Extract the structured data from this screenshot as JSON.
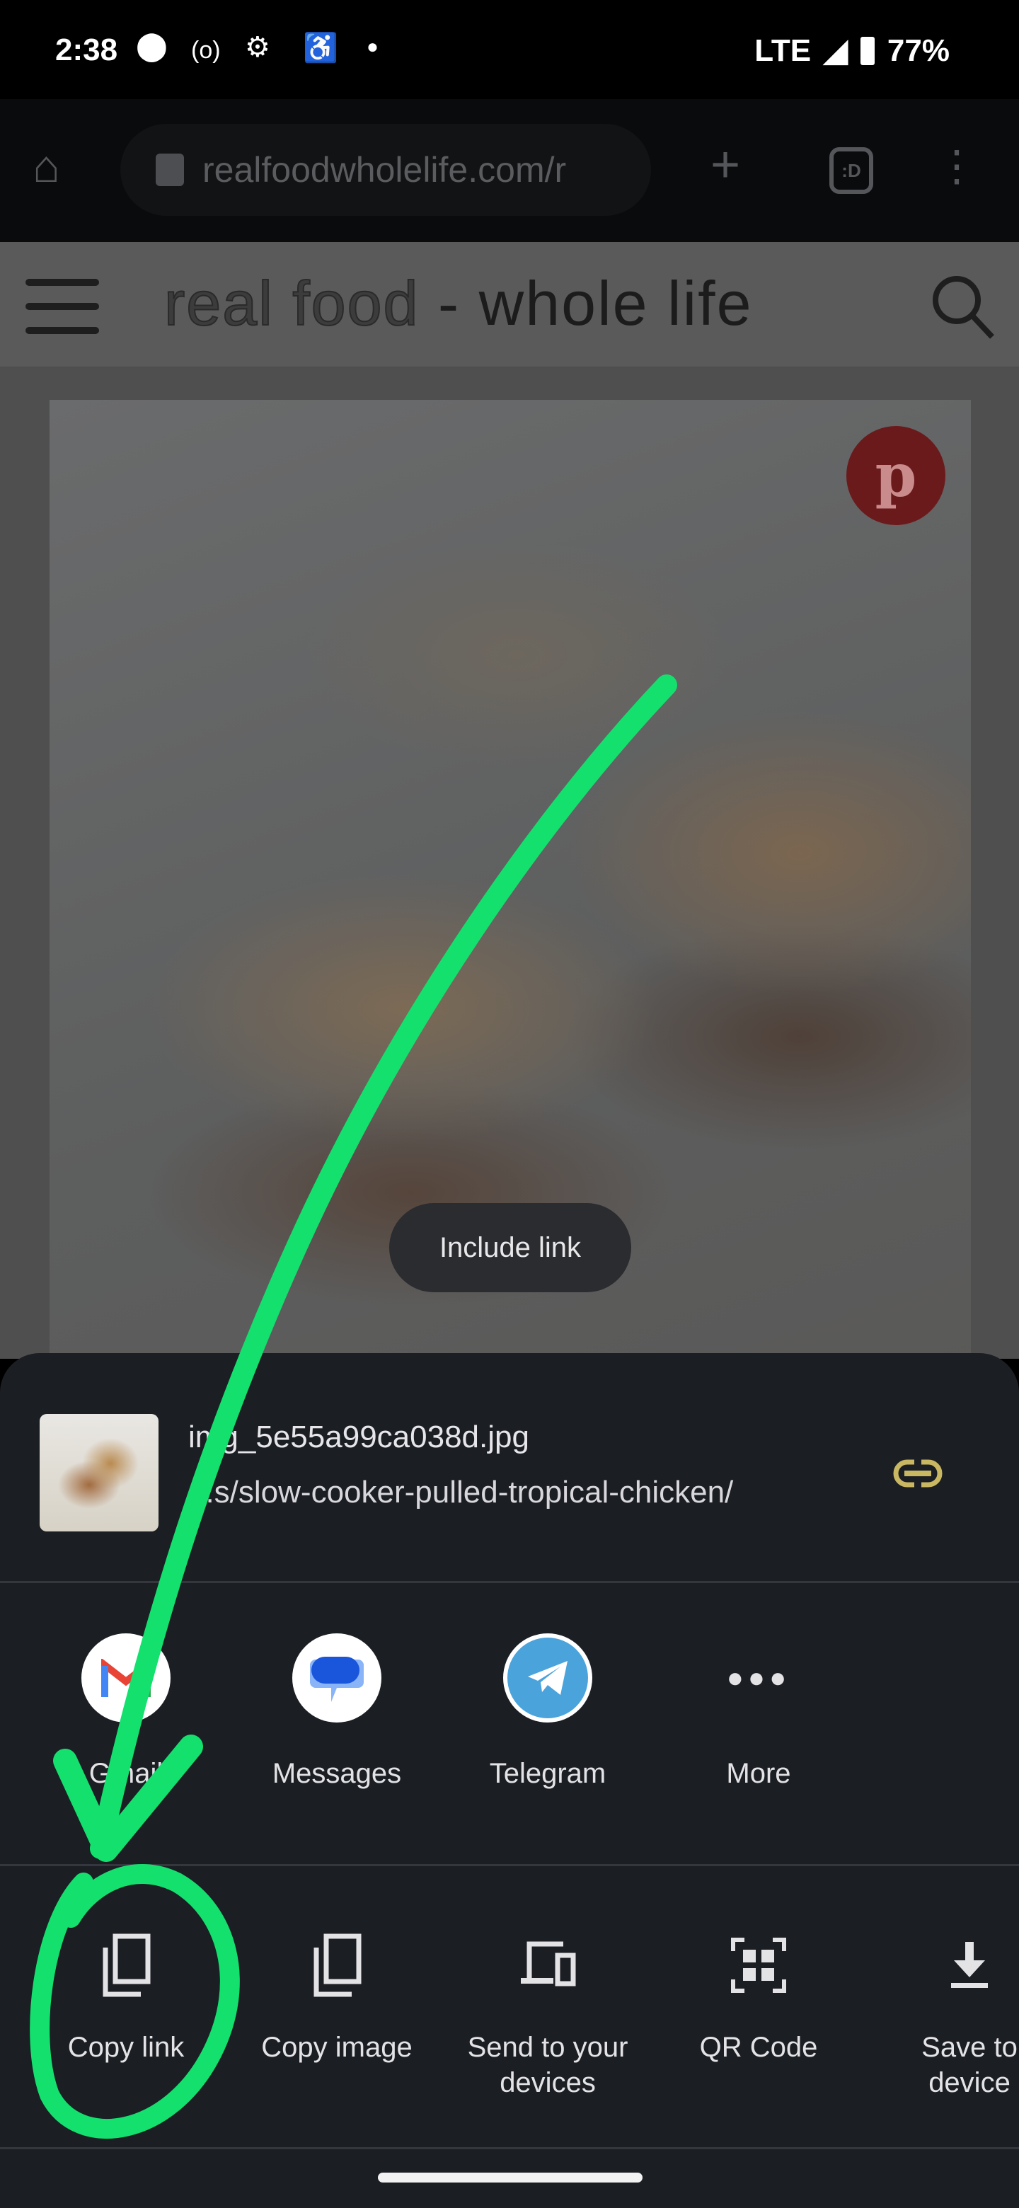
{
  "status_bar": {
    "time": "2:38",
    "network": "LTE",
    "battery": "77%",
    "icons": [
      "circle-notification-icon",
      "hotspot-icon",
      "android-debug-icon",
      "accessibility-icon",
      "dot-icon",
      "signal-icon",
      "battery-icon"
    ]
  },
  "browser": {
    "url": "realfoodwholelife.com/r",
    "tab_count": ":D",
    "icons": [
      "home-icon",
      "lock-icon",
      "new-tab-icon",
      "tab-switcher-icon",
      "menu-icon"
    ]
  },
  "site": {
    "logo_light": "real food",
    "logo_dark": "- whole life",
    "pinterest": "p"
  },
  "toast": {
    "label": "Include link"
  },
  "share_sheet": {
    "file_name": "img_5e55a99ca038d.jpg",
    "url": "...s/slow-cooker-pulled-tropical-chicken/",
    "link_icon_color": "#c9b861",
    "apps": [
      {
        "label": "Gmail"
      },
      {
        "label": "Messages"
      },
      {
        "label": "Telegram"
      },
      {
        "label": "More"
      }
    ],
    "actions": [
      {
        "label": "Copy link"
      },
      {
        "label": "Copy image"
      },
      {
        "label": "Send to your devices"
      },
      {
        "label": "QR Code"
      },
      {
        "label": "Save to device"
      }
    ]
  },
  "annotation_color": "#14e06e"
}
